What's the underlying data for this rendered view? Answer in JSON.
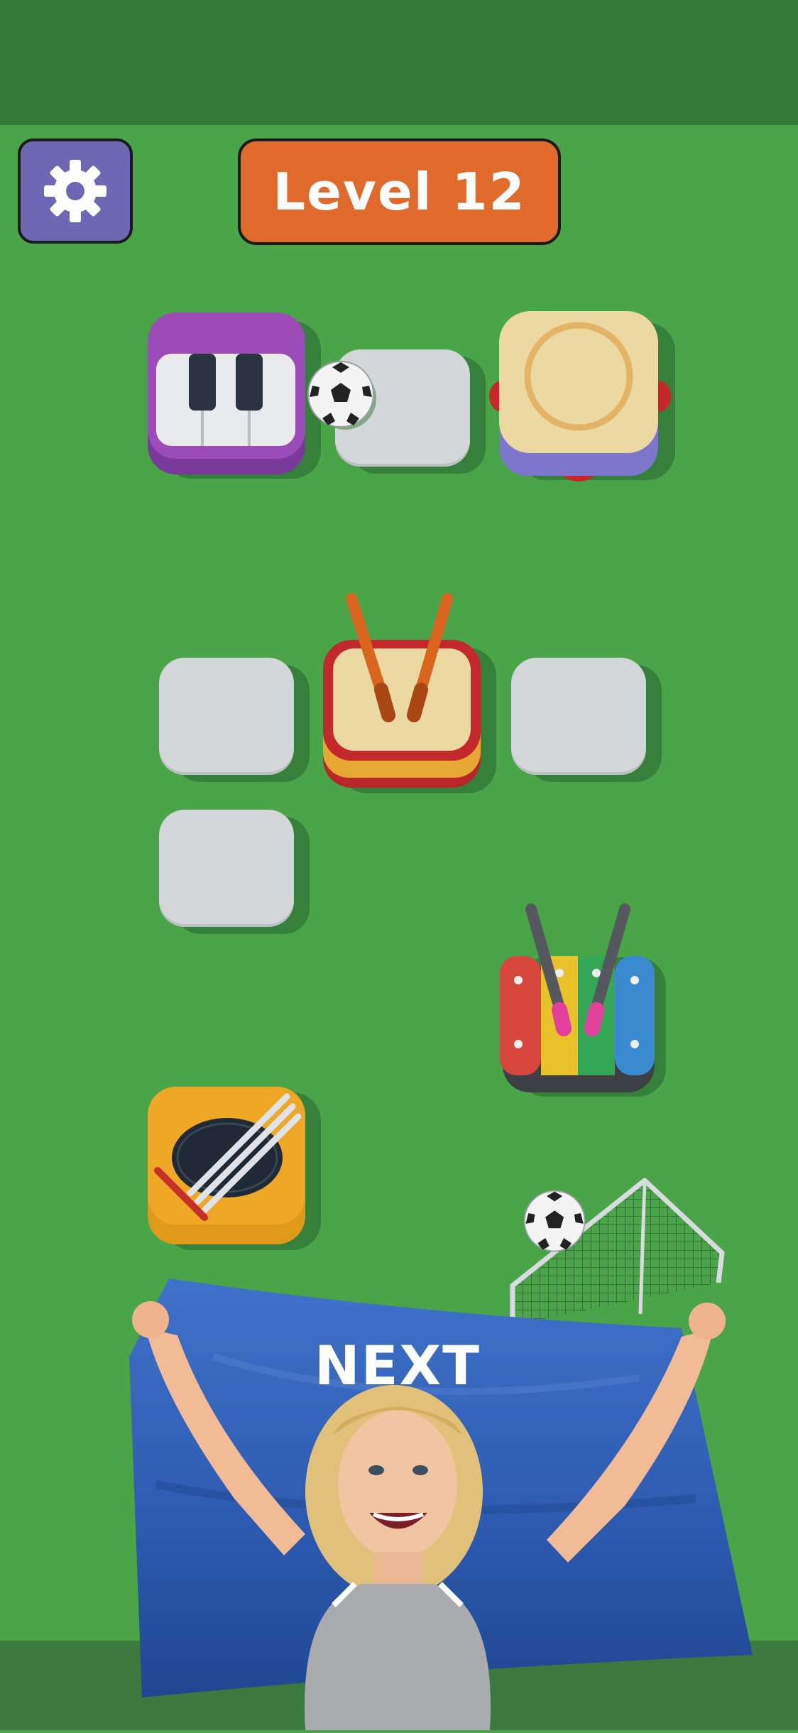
{
  "header": {
    "level_label": "Level 12",
    "settings_icon": "gear-icon"
  },
  "board": {
    "items": [
      {
        "name": "piano",
        "icon": "piano-icon"
      },
      {
        "name": "soccer-ball",
        "icon": "soccer-ball-icon"
      },
      {
        "name": "tambourine",
        "icon": "tambourine-icon"
      },
      {
        "name": "drum",
        "icon": "drum-icon"
      },
      {
        "name": "xylophone",
        "icon": "xylophone-icon"
      },
      {
        "name": "guitar",
        "icon": "guitar-icon"
      },
      {
        "name": "soccer-goal",
        "icon": "soccer-goal-icon"
      }
    ]
  },
  "banner": {
    "label": "NEXT"
  },
  "colors": {
    "background": "#4aa448",
    "top_band": "#357a39",
    "settings_button": "#6e68b4",
    "level_pill": "#e06a2c",
    "banner": "#2f5fb8",
    "empty_tile": "#d4d7d9"
  }
}
